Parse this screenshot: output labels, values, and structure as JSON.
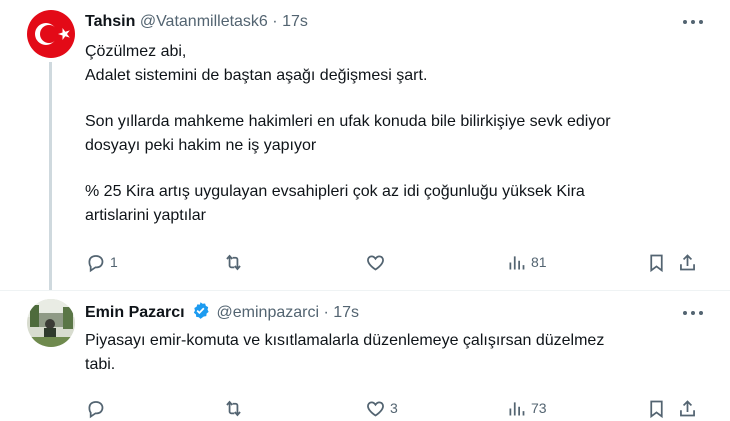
{
  "tweets": [
    {
      "name": "Tahsin",
      "handle": "@Vatanmilletask6",
      "separator": "·",
      "time": "17s",
      "lines": [
        "Çözülmez abi,",
        "Adalet sistemini de baştan aşağı değişmesi şart.",
        "",
        "Son yıllarda mahkeme hakimleri en ufak konuda bile bilirkişiye sevk ediyor",
        "dosyayı peki hakim ne iş yapıyor",
        "",
        "% 25 Kira artış uygulayan evsahipleri çok az idi çoğunluğu yüksek Kira",
        "artislarini yaptılar"
      ],
      "replies": "1",
      "retweets": "",
      "likes": "",
      "views": "81"
    },
    {
      "name": "Emin Pazarcı",
      "handle": "@eminpazarci",
      "separator": "·",
      "time": "17s",
      "lines": [
        "Piyasayı emir-komuta ve kısıtlamalarla düzenlemeye çalışırsan düzelmez",
        "tabi."
      ],
      "replies": "",
      "retweets": "",
      "likes": "3",
      "views": "73"
    }
  ],
  "icons": {
    "reply": "reply-icon",
    "retweet": "retweet-icon",
    "like": "heart-icon",
    "views": "analytics-icon",
    "bookmark": "bookmark-icon",
    "share": "share-icon",
    "more": "more-icon",
    "verified": "verified-badge-icon"
  },
  "colors": {
    "text": "#0f1419",
    "secondary": "#536471",
    "verified": "#1d9bf0",
    "flag_red": "#e30a17",
    "divider": "#eff3f4"
  }
}
